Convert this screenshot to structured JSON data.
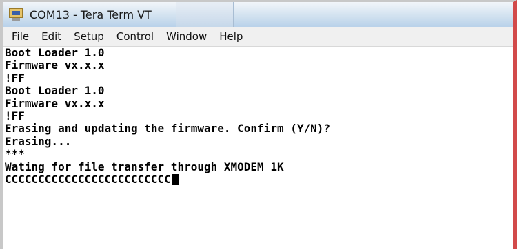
{
  "window": {
    "title": "COM13 - Tera Term VT",
    "icon": "tera-term-app-icon"
  },
  "menu": [
    "File",
    "Edit",
    "Setup",
    "Control",
    "Window",
    "Help"
  ],
  "terminal": {
    "lines": [
      "Boot Loader 1.0",
      "Firmware vx.x.x",
      "!FF",
      "Boot Loader 1.0",
      "Firmware vx.x.x",
      "!FF",
      "Erasing and updating the firmware. Confirm (Y/N)?",
      "Erasing...",
      "***",
      "Wating for file transfer through XMODEM 1K",
      "CCCCCCCCCCCCCCCCCCCCCCCCC"
    ]
  }
}
